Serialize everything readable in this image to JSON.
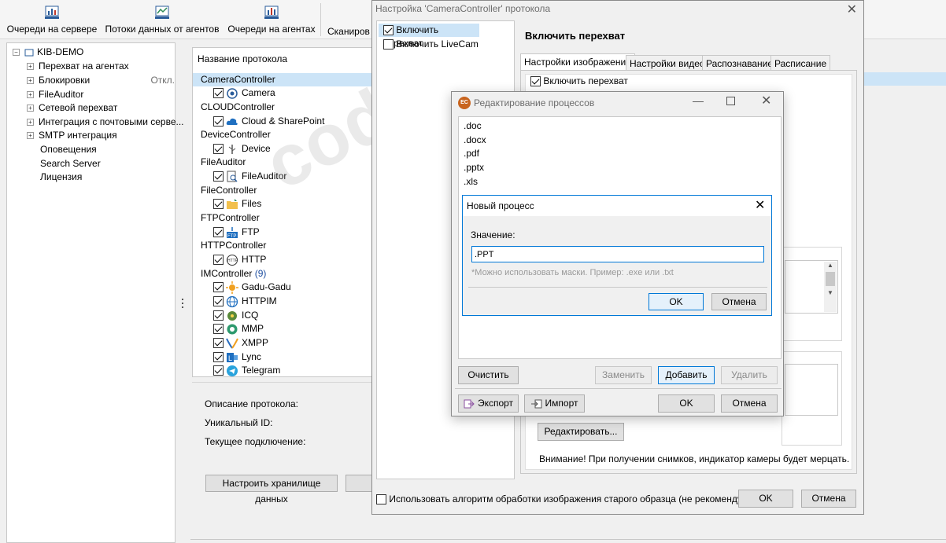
{
  "toolbar": {
    "items": [
      {
        "label": "Очереди на сервере",
        "icon": "server-queue-icon"
      },
      {
        "label": "Потоки данных от агентов",
        "icon": "data-flow-icon"
      },
      {
        "label": "Очереди на агентах",
        "icon": "agent-queue-icon"
      },
      {
        "label": "Сканиров"
      }
    ]
  },
  "tree": {
    "root": "KIB-DEMO",
    "items": [
      {
        "label": "Перехват на агентах",
        "expandable": true
      },
      {
        "label": "Блокировки",
        "expandable": true,
        "note": "Откл."
      },
      {
        "label": "FileAuditor",
        "expandable": true
      },
      {
        "label": "Сетевой перехват",
        "expandable": true
      },
      {
        "label": "Интеграция с почтовыми серве...",
        "expandable": true
      },
      {
        "label": "SMTP интеграция",
        "expandable": true
      },
      {
        "label": "Оповещения",
        "expandable": false
      },
      {
        "label": "Search Server",
        "expandable": false
      },
      {
        "label": "Лицензия",
        "expandable": false
      }
    ]
  },
  "protocols": {
    "header": "Название протокола",
    "rows": [
      {
        "type": "group",
        "label": "CameraController",
        "selected": true
      },
      {
        "type": "item",
        "label": "Camera",
        "icon": "camera-icon"
      },
      {
        "type": "group",
        "label": "CLOUDController"
      },
      {
        "type": "item",
        "label": "Cloud & SharePoint",
        "icon": "cloud-icon"
      },
      {
        "type": "group",
        "label": "DeviceController"
      },
      {
        "type": "item",
        "label": "Device",
        "icon": "usb-icon"
      },
      {
        "type": "group",
        "label": "FileAuditor"
      },
      {
        "type": "item",
        "label": "FileAuditor",
        "icon": "file-auditor-icon"
      },
      {
        "type": "group",
        "label": "FileController"
      },
      {
        "type": "item",
        "label": "Files",
        "icon": "folder-icon"
      },
      {
        "type": "group",
        "label": "FTPController"
      },
      {
        "type": "item",
        "label": "FTP",
        "icon": "ftp-icon"
      },
      {
        "type": "group",
        "label": "HTTPController"
      },
      {
        "type": "item",
        "label": "HTTP",
        "icon": "http-icon"
      },
      {
        "type": "group",
        "label": "IMController",
        "count": "(9)"
      },
      {
        "type": "item",
        "label": "Gadu-Gadu",
        "icon": "gadu-gadu-icon"
      },
      {
        "type": "item",
        "label": "HTTPIM",
        "icon": "globe-icon"
      },
      {
        "type": "item",
        "label": "ICQ",
        "icon": "icq-icon"
      },
      {
        "type": "item",
        "label": "MMP",
        "icon": "mmp-icon"
      },
      {
        "type": "item",
        "label": "XMPP",
        "icon": "xmpp-icon"
      },
      {
        "type": "item",
        "label": "Lync",
        "icon": "lync-icon"
      },
      {
        "type": "item",
        "label": "Telegram",
        "icon": "telegram-icon"
      }
    ]
  },
  "details": {
    "description_label": "Описание протокола:",
    "uid_label": "Уникальный ID:",
    "connection_label": "Текущее подключение:",
    "storage_button": "Настроить хранилище данных"
  },
  "camera_dialog": {
    "title": "Настройка 'CameraController' протокола",
    "list": [
      {
        "label": "Включить перехват",
        "checked": true
      },
      {
        "label": "Включить LiveCam",
        "checked": false
      }
    ],
    "heading": "Включить перехват",
    "tabs": [
      "Настройки изображения",
      "Настройки видео",
      "Распознавание",
      "Расписание"
    ],
    "intercept_checkbox": "Включить перехват",
    "edit_button": "Редактировать...",
    "notice": "Внимание! При получении снимков, индикатор камеры будет мерцать.",
    "old_algorithm_checkbox": "Использовать алгоритм обработки изображения старого образца (не рекомендуется)",
    "ok": "OK",
    "cancel": "Отмена"
  },
  "process_dialog": {
    "title": "Редактирование процессов",
    "items": [
      ".doc",
      ".docx",
      ".pdf",
      ".pptx",
      ".xls"
    ],
    "clear": "Очистить",
    "replace": "Заменить",
    "add": "Добавить",
    "delete": "Удалить",
    "export": "Экспорт",
    "import": "Импорт",
    "ok": "OK",
    "cancel": "Отмена"
  },
  "new_process_dialog": {
    "title": "Новый процесс",
    "value_label": "Значение:",
    "value": ".PPT",
    "hint": "*Можно использовать маски. Пример: .exe или .txt",
    "ok": "OK",
    "cancel": "Отмена"
  },
  "watermark": "codeby.net",
  "colors": {
    "selection": "#cce4f7",
    "accent": "#0078d7",
    "process_icon": "#c8641e"
  }
}
